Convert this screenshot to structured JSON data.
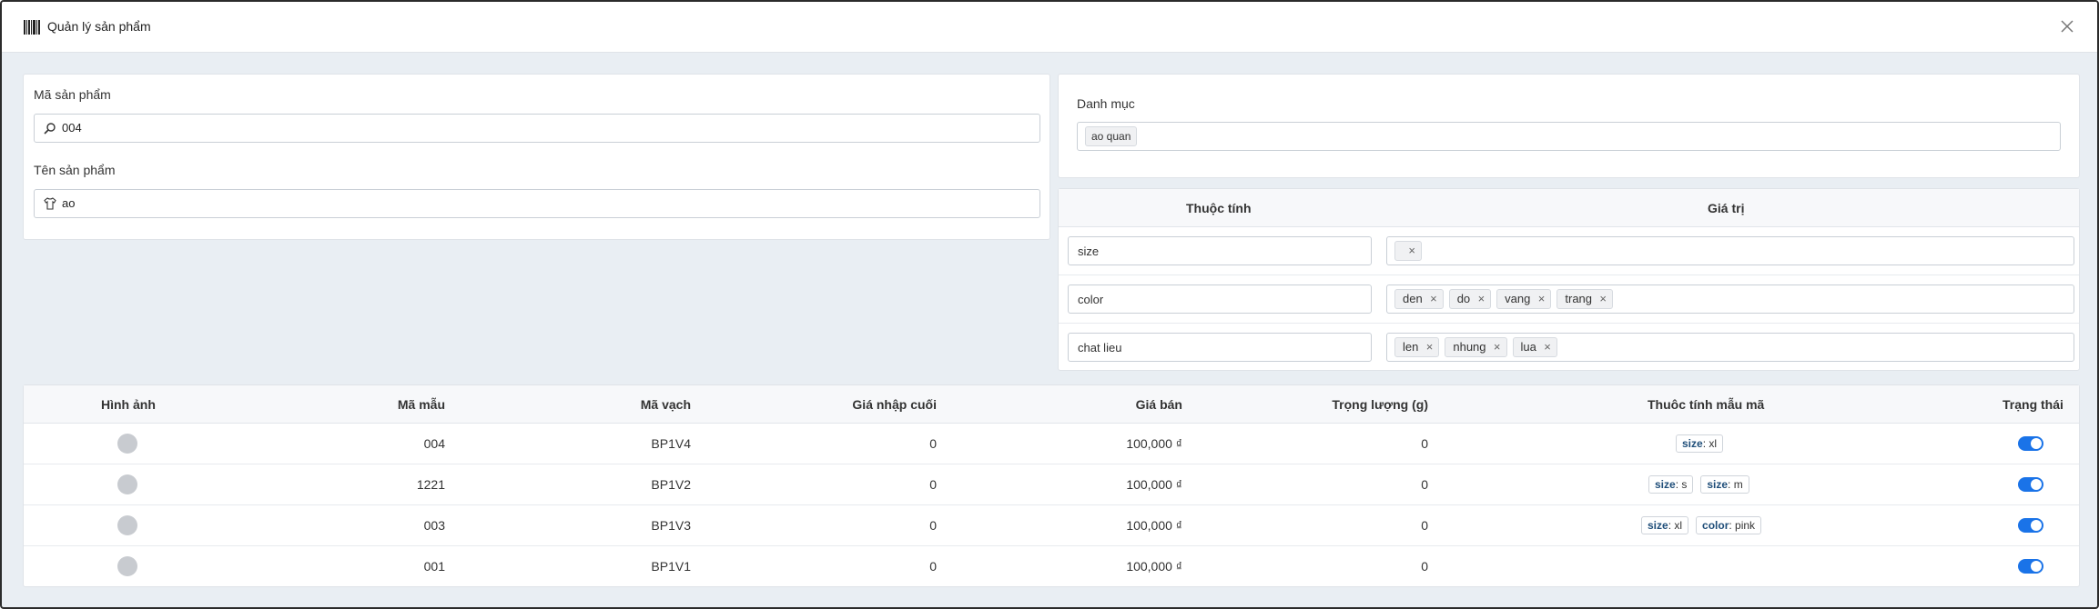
{
  "window": {
    "title": "Quản lý sản phẩm"
  },
  "product": {
    "code_label": "Mã sản phẩm",
    "code_value": "004",
    "name_label": "Tên sản phẩm",
    "name_value": "ao"
  },
  "category": {
    "label": "Danh mục",
    "tags": [
      "ao quan"
    ]
  },
  "attributes": {
    "col_name": "Thuộc tính",
    "col_value": "Giá trị",
    "rows": [
      {
        "name": "size",
        "values": [
          ""
        ]
      },
      {
        "name": "color",
        "values": [
          "den",
          "do",
          "vang",
          "trang"
        ]
      },
      {
        "name": "chat lieu",
        "values": [
          "len",
          "nhung",
          "lua"
        ]
      }
    ]
  },
  "variants": {
    "headers": {
      "image": "Hình ảnh",
      "code": "Mã mẫu",
      "barcode": "Mã vạch",
      "last_cost": "Giá nhập cuối",
      "price": "Giá bán",
      "weight": "Trọng lượng (g)",
      "attrs": "Thuôc tính mẫu mã",
      "status": "Trạng thái"
    },
    "rows": [
      {
        "code": "004",
        "barcode": "BP1V4",
        "last_cost": "0",
        "price": "100,000 ₫",
        "weight": "0",
        "attrs": [
          {
            "k": "size",
            "v": "xl"
          }
        ],
        "active": true
      },
      {
        "code": "1221",
        "barcode": "BP1V2",
        "last_cost": "0",
        "price": "100,000 ₫",
        "weight": "0",
        "attrs": [
          {
            "k": "size",
            "v": "s"
          },
          {
            "k": "size",
            "v": "m"
          }
        ],
        "active": true
      },
      {
        "code": "003",
        "barcode": "BP1V3",
        "last_cost": "0",
        "price": "100,000 ₫",
        "weight": "0",
        "attrs": [
          {
            "k": "size",
            "v": "xl"
          },
          {
            "k": "color",
            "v": "pink"
          }
        ],
        "active": true
      },
      {
        "code": "001",
        "barcode": "BP1V1",
        "last_cost": "0",
        "price": "100,000 ₫",
        "weight": "0",
        "attrs": [],
        "active": true
      }
    ]
  },
  "colors": {
    "accent": "#1a73e8",
    "background": "#e9eef3"
  }
}
